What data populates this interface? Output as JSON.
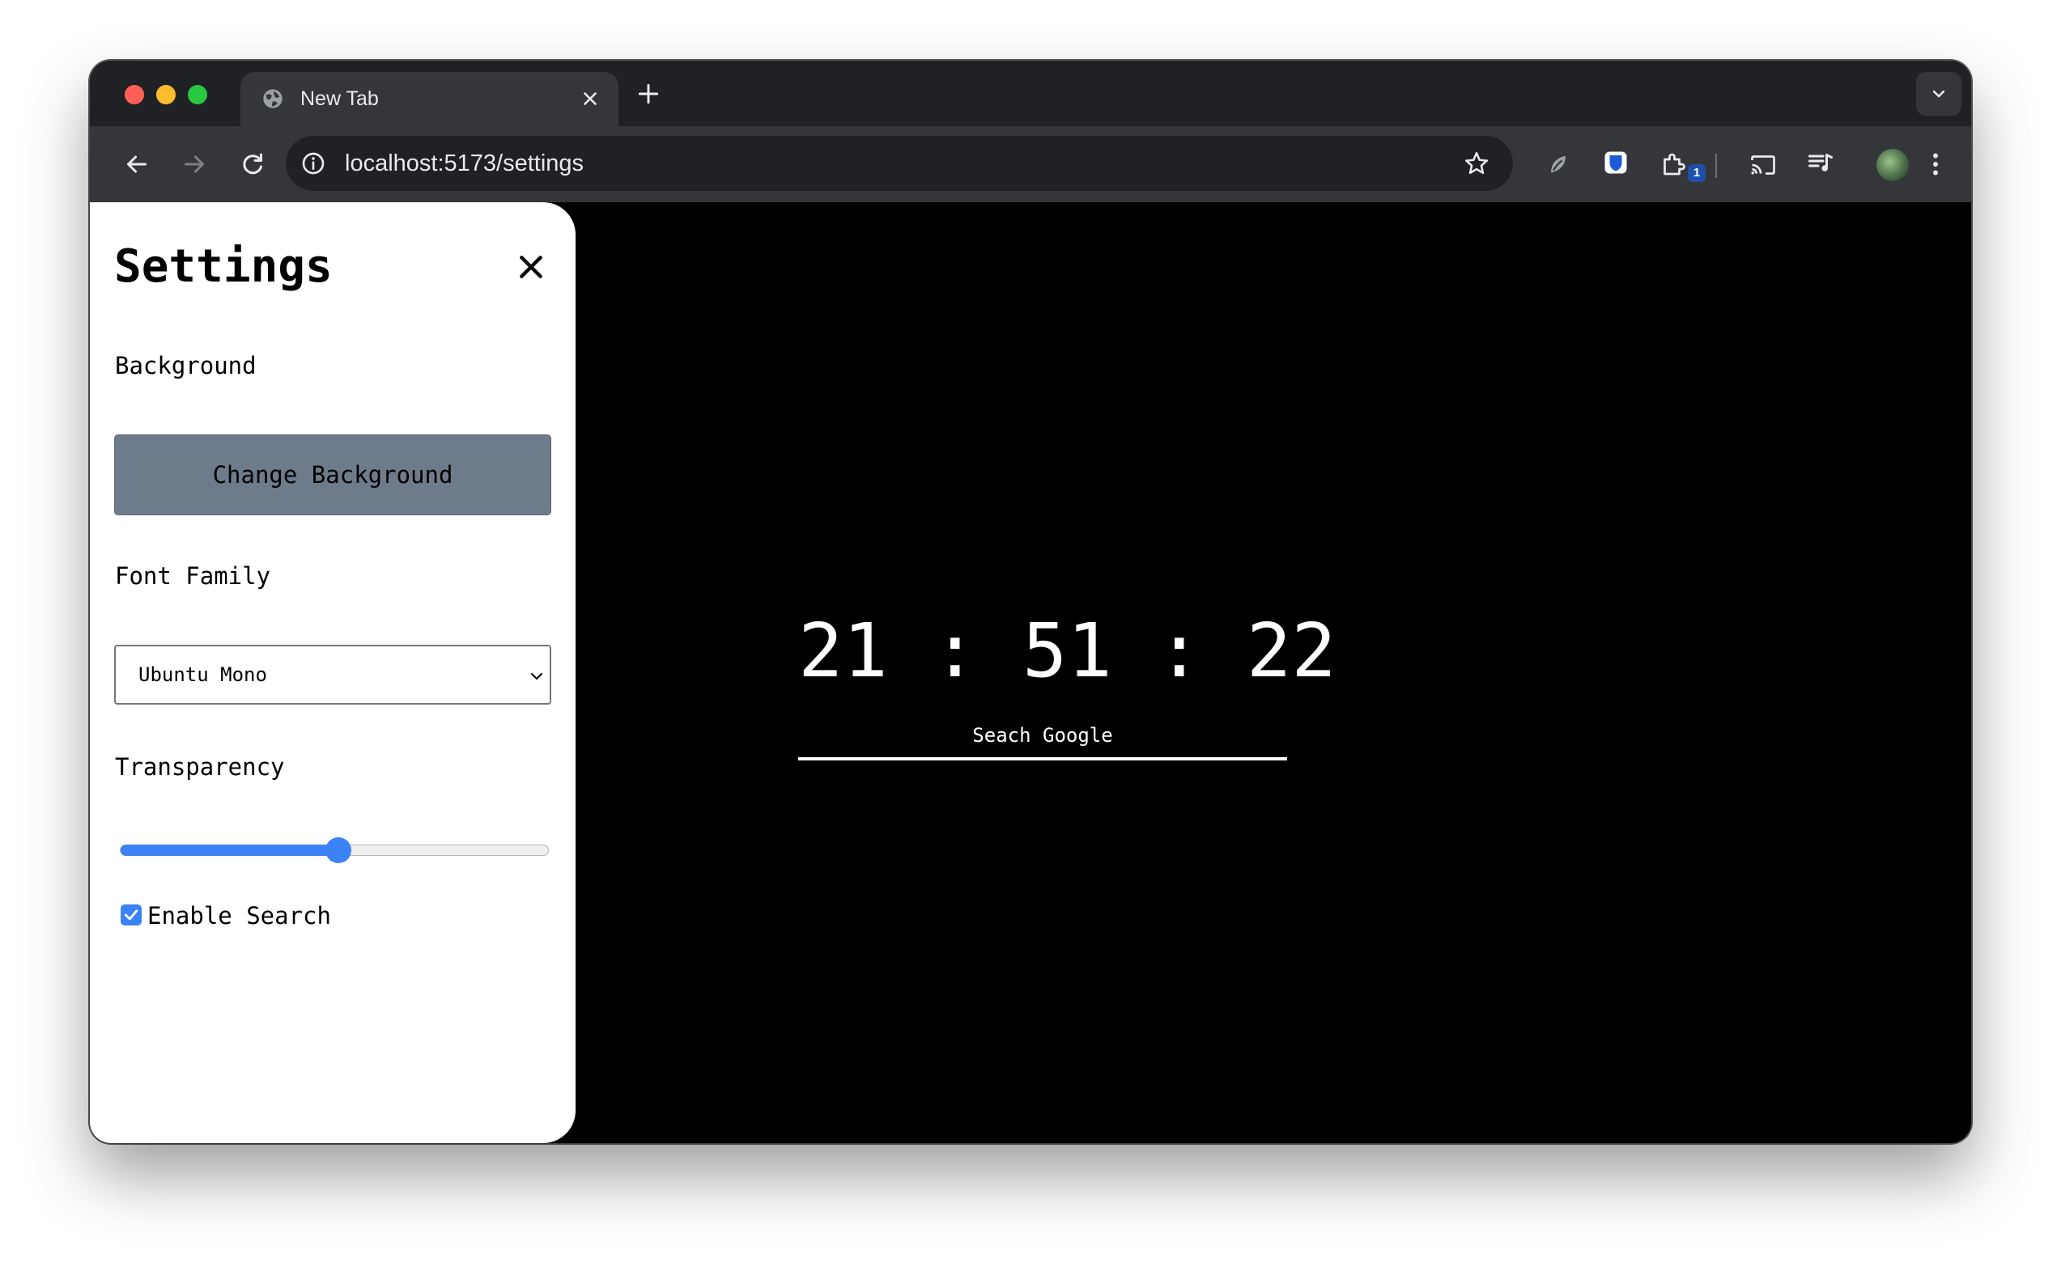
{
  "browser": {
    "tab_title": "New Tab",
    "url": "localhost:5173/settings",
    "extension_badge": "1"
  },
  "settings": {
    "title": "Settings",
    "background_label": "Background",
    "change_background_button": "Change Background",
    "font_family_label": "Font Family",
    "font_family_selected": "Ubuntu Mono",
    "transparency_label": "Transparency",
    "transparency_value": 0.5,
    "enable_search_label": "Enable Search",
    "enable_search_checked": true
  },
  "main": {
    "clock": "21 : 51 : 22",
    "search_label": "Seach Google"
  },
  "colors": {
    "accent": "#3b82f6",
    "button_bg": "#6e7b8b",
    "page_bg": "#000000",
    "panel_bg": "#ffffff"
  }
}
